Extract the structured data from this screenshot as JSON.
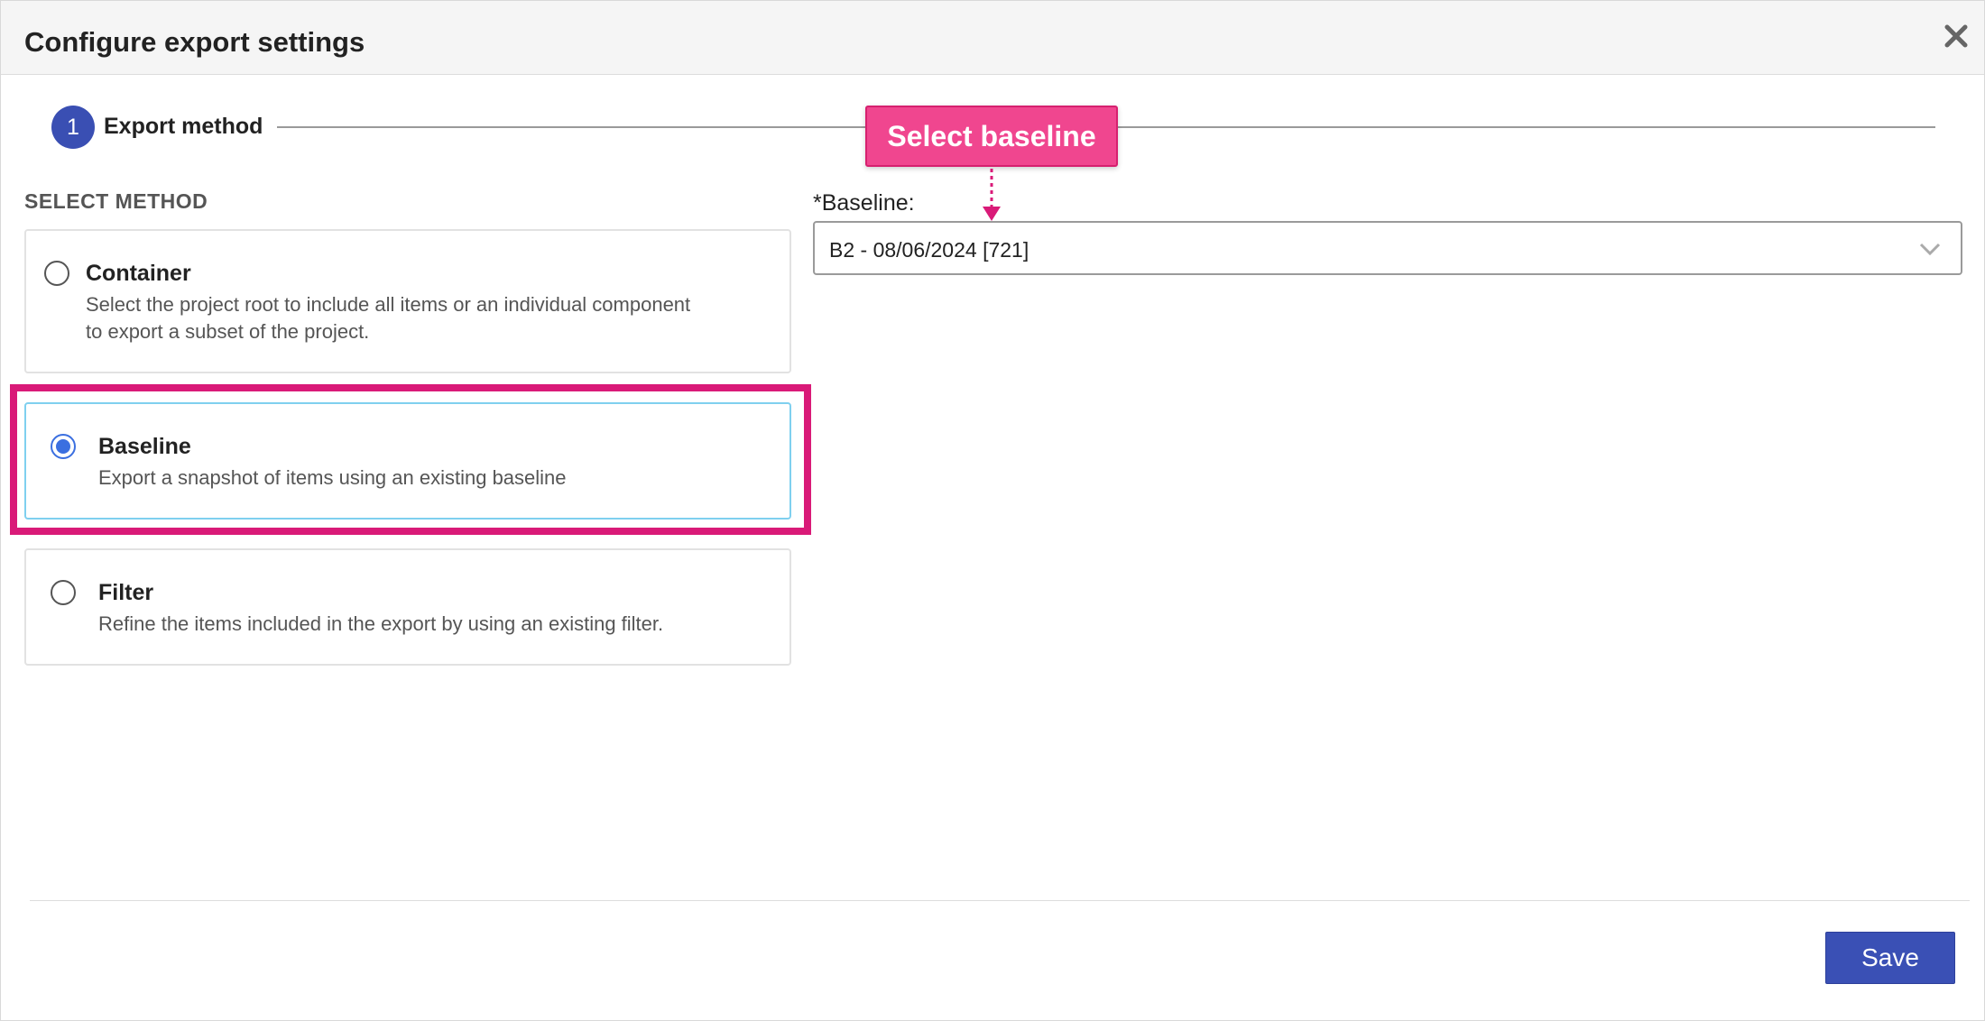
{
  "dialog": {
    "title": "Configure export settings",
    "close_icon": "close-icon"
  },
  "stepper": {
    "step_number": "1",
    "step_label": "Export method"
  },
  "callout": {
    "text": "Select baseline",
    "color": "#f0468f"
  },
  "method_section": {
    "label": "SELECT METHOD",
    "options": [
      {
        "title": "Container",
        "description_line1": "Select the project root to include all items or an individual component",
        "description_line2": "to export a subset of the project.",
        "selected": false
      },
      {
        "title": "Baseline",
        "description": "Export a snapshot of items using an existing baseline",
        "selected": true
      },
      {
        "title": "Filter",
        "description": "Refine the items included in the export by using an existing filter.",
        "selected": false
      }
    ],
    "highlight_color": "#d91a78"
  },
  "baseline_field": {
    "label": "*Baseline:",
    "value": "B2 - 08/06/2024 [721]",
    "chevron_icon": "chevron-down-icon"
  },
  "footer": {
    "save_label": "Save",
    "accent_color": "#3a50b5"
  }
}
